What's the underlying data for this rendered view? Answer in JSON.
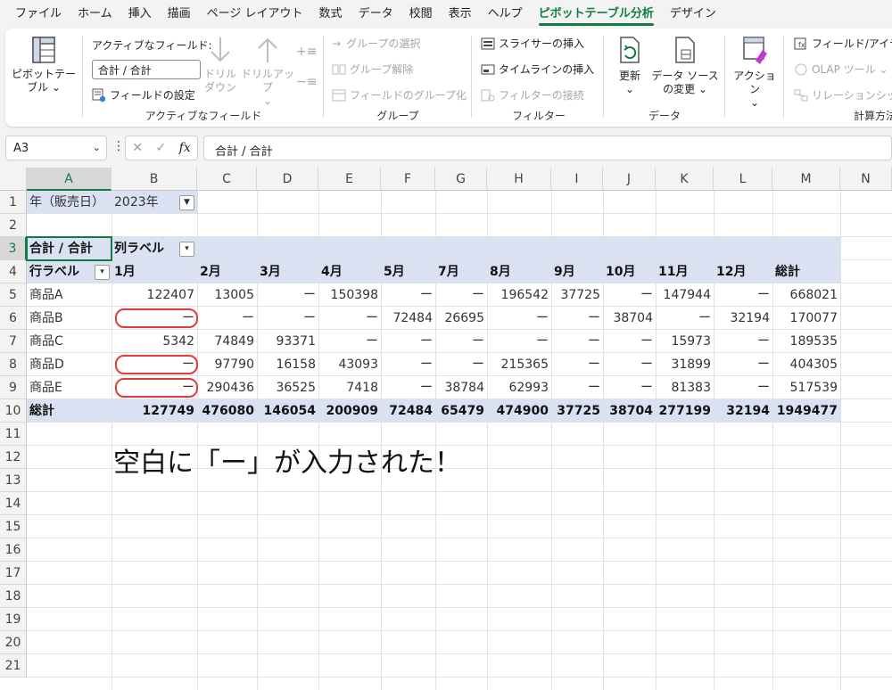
{
  "tabs": [
    "ファイル",
    "ホーム",
    "挿入",
    "描画",
    "ページ レイアウト",
    "数式",
    "データ",
    "校閲",
    "表示",
    "ヘルプ",
    "ピボットテーブル分析",
    "デザイン"
  ],
  "active_tab": "ピボットテーブル分析",
  "ribbon": {
    "pivot": {
      "label1": "ピボットテー",
      "label2": "ブル ⌄"
    },
    "active_field": {
      "caption": "アクティブなフィールド:",
      "value": "合計 / 合計",
      "settings": "フィールドの設定",
      "drill_down1": "ドリル",
      "drill_down2": "ダウン",
      "drill_up1": "ドリルアップ",
      "drill_up2": "⌄",
      "group_label": "アクティブなフィールド"
    },
    "group": {
      "select": "グループの選択",
      "ungroup": "グループ解除",
      "field_group": "フィールドのグループ化",
      "group_label": "グループ"
    },
    "filter": {
      "slicer": "スライサーの挿入",
      "timeline": "タイムラインの挿入",
      "connect": "フィルターの接続",
      "group_label": "フィルター"
    },
    "data": {
      "refresh1": "更新",
      "refresh2": "⌄",
      "source1": "データ ソース",
      "source2": "の変更 ⌄",
      "group_label": "データ"
    },
    "action": {
      "label1": "アクション",
      "label2": "⌄"
    },
    "calc": {
      "fields": "フィールド/アイテ",
      "olap": "OLAP ツール ⌄",
      "relation": "リレーションシップ",
      "group_label": "計算方法"
    }
  },
  "formula_bar": {
    "name_box": "A3",
    "fx": "fx",
    "formula": "合計 / 合計"
  },
  "columns": [
    "A",
    "B",
    "C",
    "D",
    "E",
    "F",
    "G",
    "H",
    "I",
    "J",
    "K",
    "L",
    "M",
    "N"
  ],
  "rows": [
    "1",
    "2",
    "3",
    "4",
    "5",
    "6",
    "7",
    "8",
    "9",
    "10",
    "11",
    "12",
    "13",
    "14",
    "15",
    "16",
    "17",
    "18",
    "19",
    "20",
    "21"
  ],
  "sheet": {
    "r1": {
      "a": "年（販売日）",
      "b": "2023年"
    },
    "r3": {
      "a": "合計 / 合計",
      "b": "列ラベル"
    },
    "header": [
      "行ラベル",
      "1月",
      "2月",
      "3月",
      "4月",
      "5月",
      "7月",
      "8月",
      "9月",
      "10月",
      "11月",
      "12月",
      "総計"
    ],
    "body": [
      [
        "商品A",
        "122407",
        "13005",
        "ー",
        "150398",
        "ー",
        "ー",
        "196542",
        "37725",
        "ー",
        "147944",
        "ー",
        "668021"
      ],
      [
        "商品B",
        "ー",
        "ー",
        "ー",
        "ー",
        "72484",
        "26695",
        "ー",
        "ー",
        "38704",
        "ー",
        "32194",
        "170077"
      ],
      [
        "商品C",
        "5342",
        "74849",
        "93371",
        "ー",
        "ー",
        "ー",
        "ー",
        "ー",
        "ー",
        "15973",
        "ー",
        "189535"
      ],
      [
        "商品D",
        "ー",
        "97790",
        "16158",
        "43093",
        "ー",
        "ー",
        "215365",
        "ー",
        "ー",
        "31899",
        "ー",
        "404305"
      ],
      [
        "商品E",
        "ー",
        "290436",
        "36525",
        "7418",
        "ー",
        "38784",
        "62993",
        "ー",
        "ー",
        "81383",
        "ー",
        "517539"
      ]
    ],
    "total": [
      "総計",
      "127749",
      "476080",
      "146054",
      "200909",
      "72484",
      "65479",
      "474900",
      "37725",
      "38704",
      "277199",
      "32194",
      "1949477"
    ]
  },
  "annotation": "空白に「ー」が入力された！",
  "colors": {
    "accent": "#107c41",
    "pivot_band": "#d9e1f2",
    "highlight": "#e23b3b"
  }
}
